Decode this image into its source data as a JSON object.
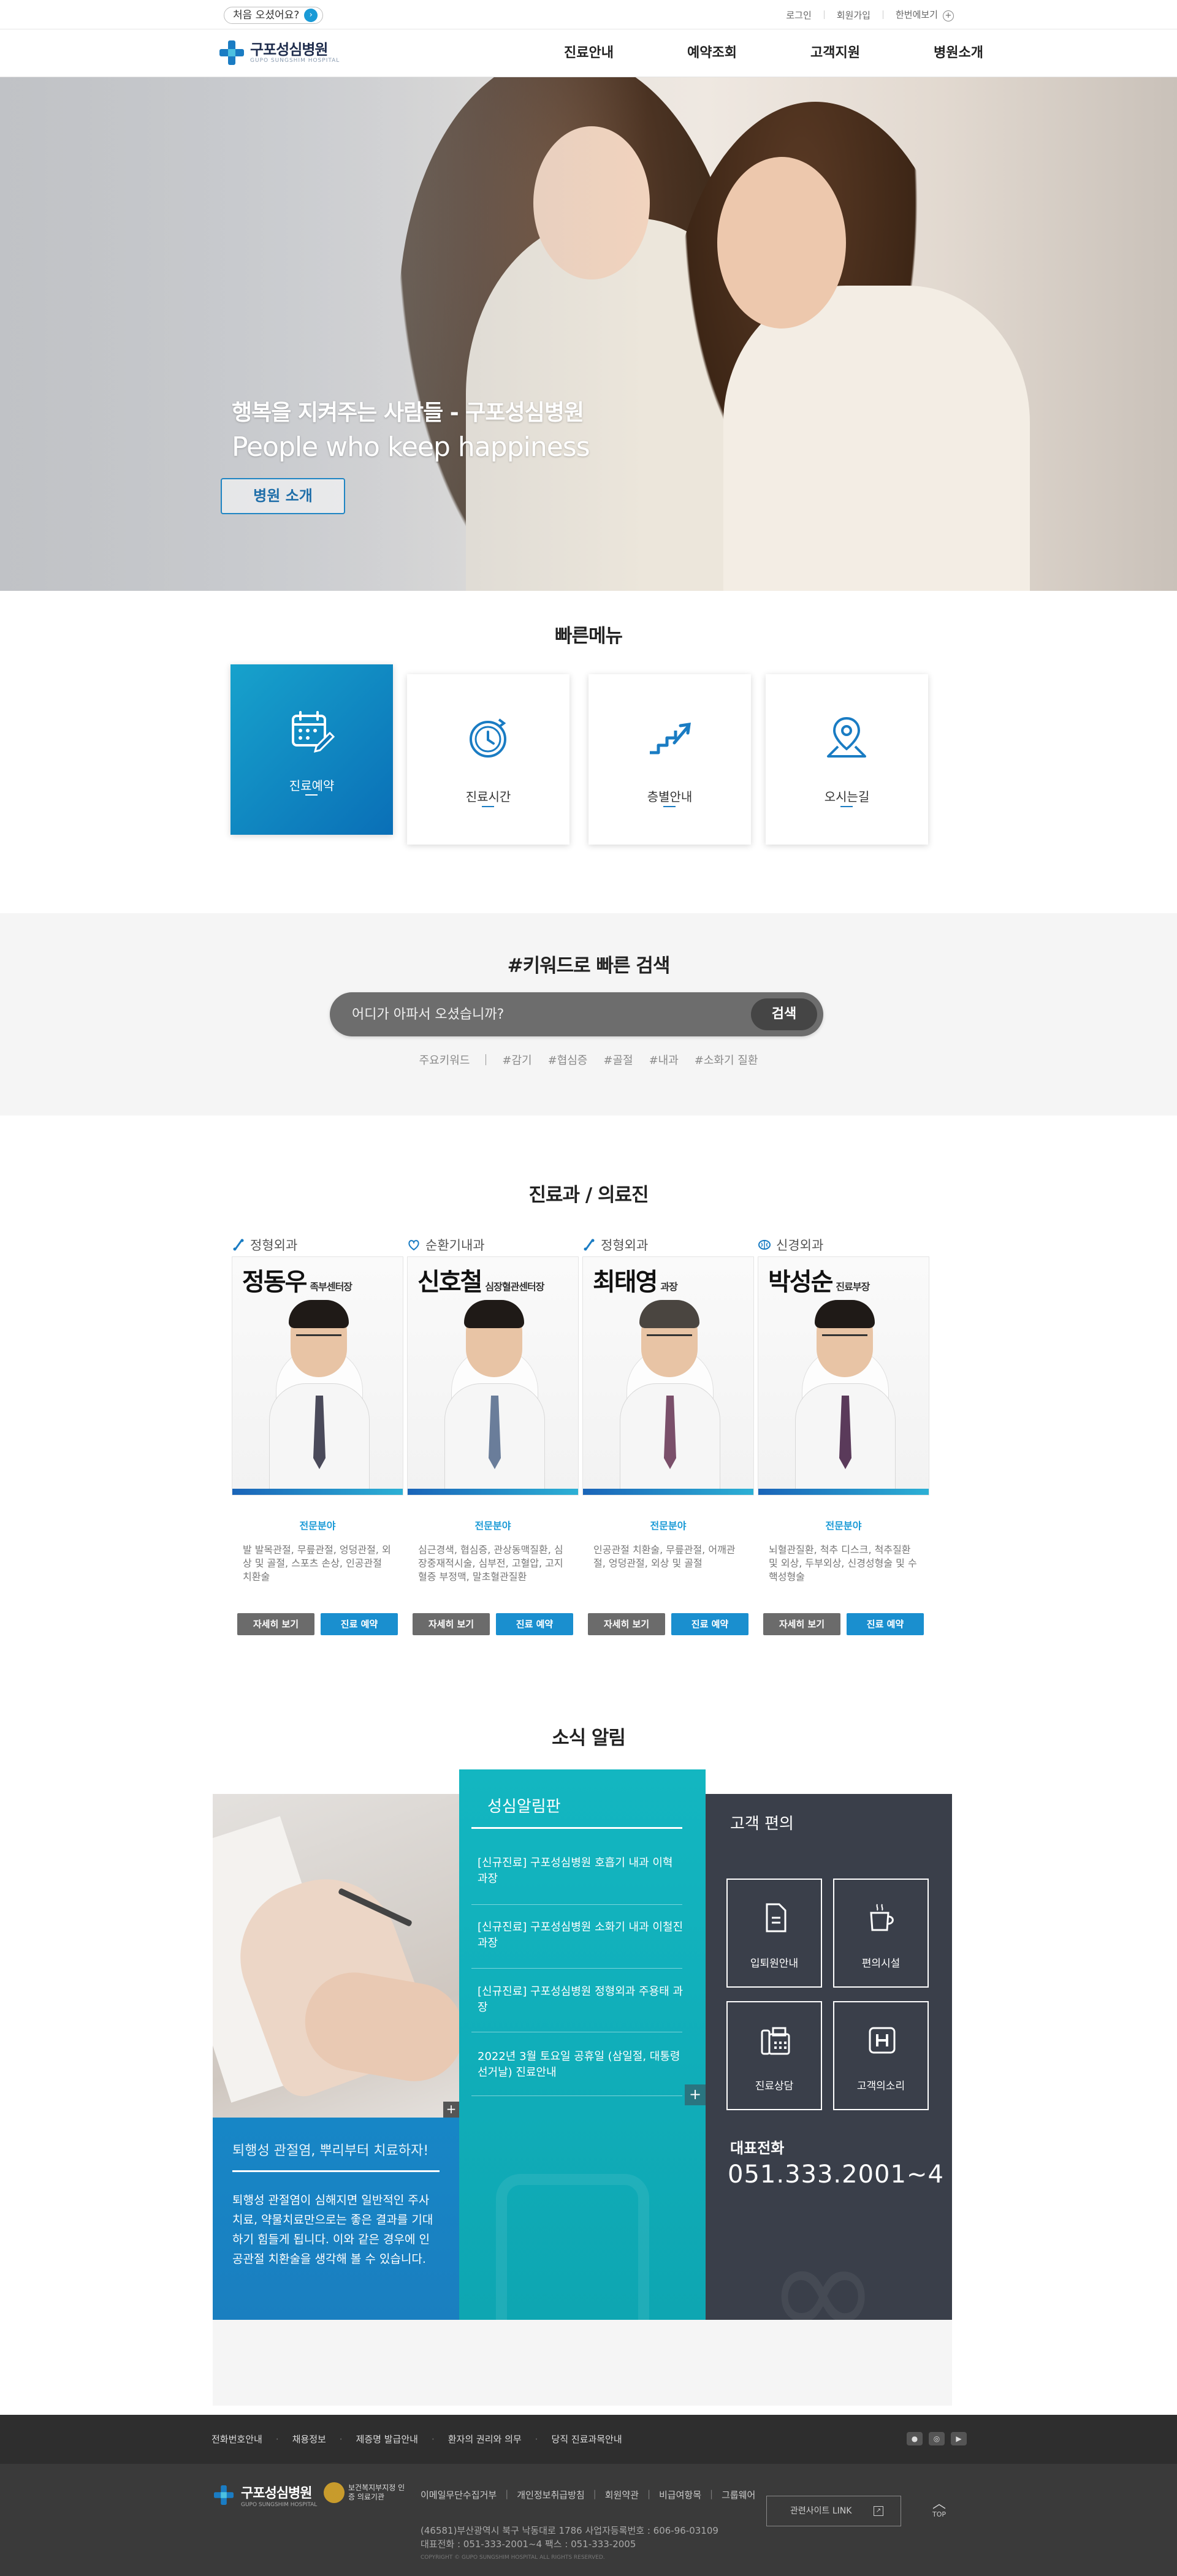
{
  "util": {
    "first_visit": "처음 오셨어요?",
    "login": "로그인",
    "join": "회원가입",
    "sitemap": "한번에보기"
  },
  "header": {
    "logo_ko": "구포성심병원",
    "logo_en": "GUPO SUNGSHIM HOSPITAL",
    "nav": [
      "진료안내",
      "예약조회",
      "고객지원",
      "병원소개"
    ]
  },
  "hero": {
    "title_ko": "행복을 지켜주는 사람들 - 구포성심병원",
    "title_en": "People who keep happiness",
    "button": "병원 소개"
  },
  "quick": {
    "title": "빠른메뉴",
    "items": [
      {
        "label": "진료예약",
        "icon": "calendar-edit-icon"
      },
      {
        "label": "진료시간",
        "icon": "clock-icon"
      },
      {
        "label": "층별안내",
        "icon": "stairs-icon"
      },
      {
        "label": "오시는길",
        "icon": "map-pin-icon"
      }
    ]
  },
  "keyword": {
    "title": "#키워드로 빠른 검색",
    "placeholder": "어디가 아파서 오셨습니까?",
    "button": "검색",
    "label": "주요키워드",
    "tags": [
      "#감기",
      "#협심증",
      "#골절",
      "#내과",
      "#소화기 질환"
    ]
  },
  "doctors": {
    "title": "진료과 / 의료진",
    "specialty_label": "전문분야",
    "more_label": "자세히 보기",
    "reserve_label": "진료 예약",
    "items": [
      {
        "dept": "정형외과",
        "name": "정동우",
        "position": "족부센터장",
        "desc": "발 발목관절, 무릎관절, 엉덩관절, 외상 및 골절, 스포츠 손상, 인공관절 치환술"
      },
      {
        "dept": "순환기내과",
        "name": "신호철",
        "position": "심장혈관센터장",
        "desc": "심근경색, 협심증, 관상동맥질환, 심장중재적시술, 심부전, 고혈압, 고지혈증 부정맥, 말초혈관질환"
      },
      {
        "dept": "정형외과",
        "name": "최태영",
        "position": "과장",
        "desc": "인공관절 치환술, 무릎관절, 어깨관절, 엉덩관절, 외상 및 골절"
      },
      {
        "dept": "신경외과",
        "name": "박성순",
        "position": "진료부장",
        "desc": "뇌혈관질환, 척추 디스크, 척추질환 및 외상, 두부외상, 신경성형술 및 수핵성형술"
      }
    ]
  },
  "news": {
    "title": "소식 알림",
    "feature": {
      "title": "퇴행성 관절염, 뿌리부터 치료하자!",
      "desc": "퇴행성 관절염이 심해지면 일반적인 주사치료, 약물치료만으로는 좋은 결과를 기대하기 힘들게 됩니다. 이와 같은 경우에 인공관절 치환술을 생각해 볼 수 있습니다."
    },
    "board": {
      "title": "성심알림판",
      "items": [
        "[신규진료] 구포성심병원 호흡기 내과 이혁 과장",
        "[신규진료] 구포성심병원 소화기 내과 이철진 과장",
        "[신규진료] 구포성심병원 정형외과 주용태 과장",
        "2022년 3월 토요일 공휴일 (삼일절, 대통령선거날) 진료안내"
      ]
    },
    "service": {
      "title": "고객 편의",
      "items": [
        {
          "label": "입퇴원안내",
          "icon": "document-icon"
        },
        {
          "label": "편의시설",
          "icon": "coffee-cup-icon"
        },
        {
          "label": "진료상담",
          "icon": "fax-phone-icon"
        },
        {
          "label": "고객의소리",
          "icon": "hospital-h-icon"
        }
      ],
      "tel_label": "대표전화",
      "tel": "051.333.2001~4"
    }
  },
  "footer": {
    "links": [
      "전화번호안내",
      "채용정보",
      "제증명 발급안내",
      "환자의 권리와 의무",
      "당직 진료과목안내"
    ],
    "sns": [
      "talk-icon",
      "instagram-icon",
      "youtube-icon"
    ],
    "logo_ko": "구포성심병원",
    "logo_en": "GUPO SUNGSHIM HOSPITAL",
    "badge": "보건복지부지정 인증 의료기관",
    "menu": [
      "이메일무단수집거부",
      "개인정보취급방침",
      "회원약관",
      "비급여항목",
      "그룹웨어"
    ],
    "address": "(46581)부산광역시 북구 낙동대로 1786 사업자등록번호 : 606-96-03109",
    "phone": "대표전화 : 051-333-2001~4  팩스 : 051-333-2005",
    "copyright": "COPYRIGHT © GUPO SUNGSHIM HOSPITAL ALL RIGHTS RESERVED.",
    "related": "관련사이트 LINK",
    "top": "TOP"
  },
  "colors": {
    "primary": "#1a7cc3",
    "teal": "#13b6c1",
    "dark": "#3a3f4a"
  }
}
